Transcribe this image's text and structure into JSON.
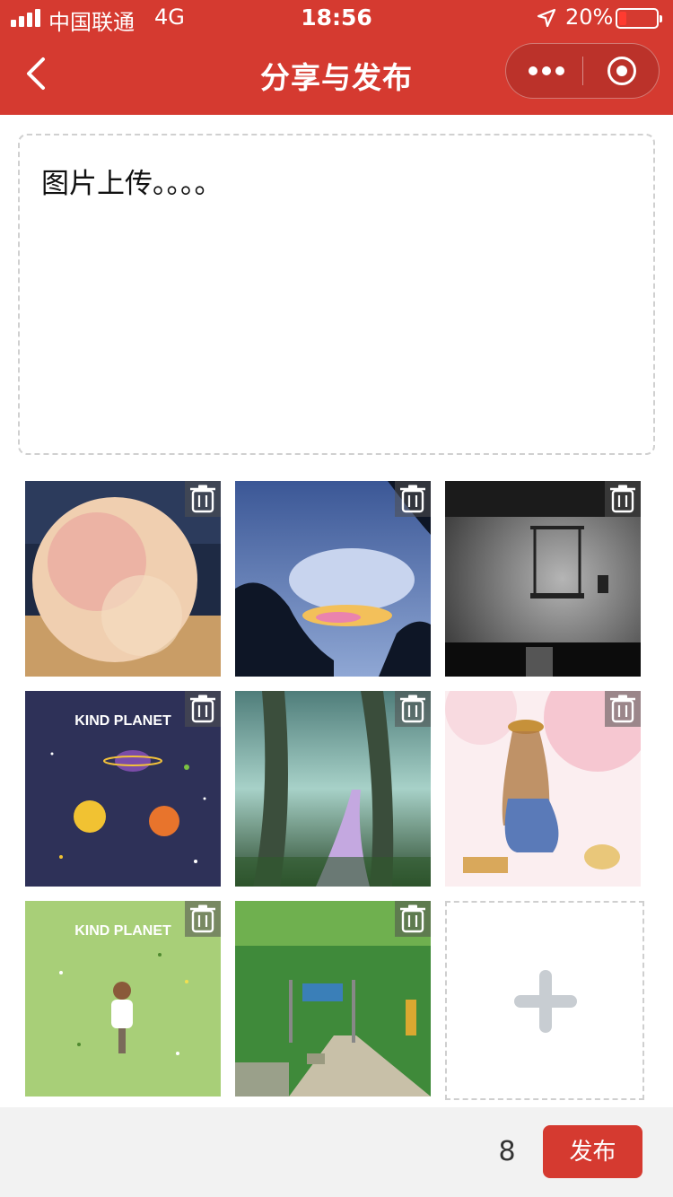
{
  "status_bar": {
    "carrier": "中国联通",
    "network": "4G",
    "time": "18:56",
    "battery_percent": "20%",
    "battery_level": 0.2
  },
  "nav": {
    "title": "分享与发布",
    "back_icon": "chevron-left-icon",
    "more_icon": "more-dots-icon",
    "close_icon": "target-circle-icon"
  },
  "post": {
    "text": "图片上传。。。。"
  },
  "images": [
    {
      "subject": "peach",
      "colors": [
        "#e8c3a0",
        "#c9a26f"
      ]
    },
    {
      "subject": "sky-with-iridescent-cloud",
      "colors": [
        "#3e5a9a",
        "#0f1a2e"
      ]
    },
    {
      "subject": "grayscale-game-scene",
      "colors": [
        "#9a9a9a",
        "#111111"
      ]
    },
    {
      "subject": "kind-planet-space",
      "caption": "KIND PLANET",
      "colors": [
        "#2e3158",
        "#f0a032"
      ]
    },
    {
      "subject": "forest-path",
      "colors": [
        "#6aa0a8",
        "#2d4a2a"
      ]
    },
    {
      "subject": "girl-with-hat-watercolor",
      "colors": [
        "#f5d0d0",
        "#5a7ab8"
      ]
    },
    {
      "subject": "kind-planet-green",
      "caption": "KIND PLANET",
      "colors": [
        "#a8cf78",
        "#ffffff"
      ]
    },
    {
      "subject": "road-town-anime",
      "colors": [
        "#3f8a3a",
        "#c8c0a8"
      ]
    }
  ],
  "delete_icon": "trash-icon",
  "add_icon": "plus-icon",
  "footer": {
    "count": "8",
    "publish_label": "发布"
  },
  "colors": {
    "brand_red": "#d53a30",
    "footer_bg": "#f2f2f2",
    "dashed_border": "#d0d0d0"
  }
}
